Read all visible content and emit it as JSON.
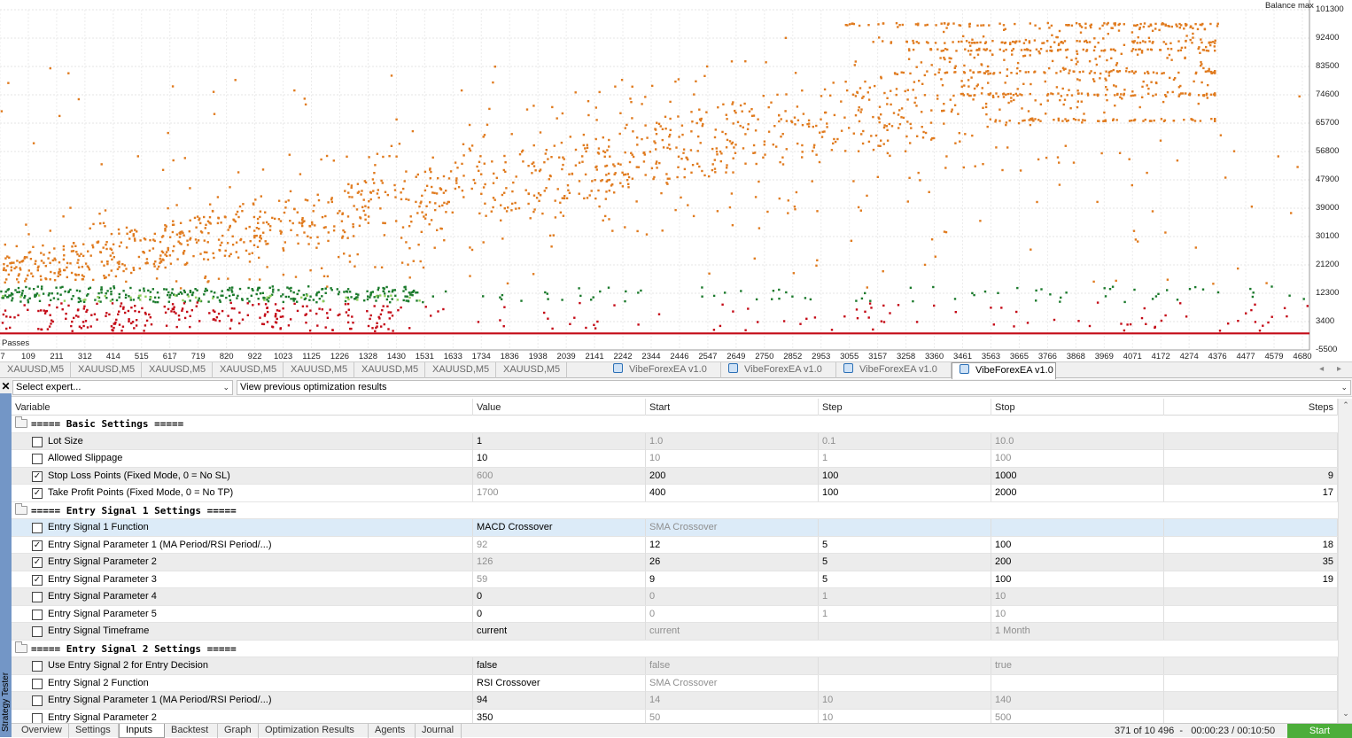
{
  "chart": {
    "y_title": "Balance max",
    "x_title": "Passes",
    "y_ticks": [
      "101300",
      "92400",
      "83500",
      "74600",
      "65700",
      "56800",
      "47900",
      "39000",
      "30100",
      "21200",
      "12300",
      "3400",
      "-5500"
    ],
    "x_ticks": [
      "7",
      "109",
      "211",
      "312",
      "414",
      "515",
      "617",
      "719",
      "820",
      "922",
      "1023",
      "1125",
      "1226",
      "1328",
      "1430",
      "1531",
      "1633",
      "1734",
      "1836",
      "1938",
      "2039",
      "2141",
      "2242",
      "2344",
      "2446",
      "2547",
      "2649",
      "2750",
      "2852",
      "2953",
      "3055",
      "3157",
      "3258",
      "3360",
      "3461",
      "3563",
      "3665",
      "3766",
      "3868",
      "3969",
      "4071",
      "4172",
      "4274",
      "4376",
      "4477",
      "4579",
      "4680"
    ],
    "colors": {
      "profit": "#e07b1f",
      "mid": "#1b7a2c",
      "loss": "#c40a16",
      "light": "#8fcf5a"
    }
  },
  "chart_data": {
    "type": "scatter",
    "xlabel": "Passes",
    "ylabel": "Balance max",
    "xlim": [
      7,
      4720
    ],
    "ylim": [
      -5500,
      101300
    ],
    "series": []
  },
  "chart_tabs": [
    {
      "label": "XAUUSD,M5",
      "icon": false,
      "active": false
    },
    {
      "label": "XAUUSD,M5",
      "icon": false,
      "active": false
    },
    {
      "label": "XAUUSD,M5",
      "icon": false,
      "active": false
    },
    {
      "label": "XAUUSD,M5",
      "icon": false,
      "active": false
    },
    {
      "label": "XAUUSD,M5",
      "icon": false,
      "active": false
    },
    {
      "label": "XAUUSD,M5",
      "icon": false,
      "active": false
    },
    {
      "label": "XAUUSD,M5",
      "icon": false,
      "active": false
    },
    {
      "label": "XAUUSD,M5",
      "icon": false,
      "active": false
    },
    {
      "label": "VibeForexEA v1.0",
      "icon": true,
      "active": false
    },
    {
      "label": "VibeForexEA v1.0",
      "icon": true,
      "active": false
    },
    {
      "label": "VibeForexEA v1.0",
      "icon": true,
      "active": false
    },
    {
      "label": "VibeForexEA v1.0",
      "icon": true,
      "active": true
    }
  ],
  "side_panel": {
    "label": "Strategy Tester"
  },
  "toolbar": {
    "expert_select": "Select expert...",
    "results_select": "View previous optimization results"
  },
  "grid": {
    "headers": [
      "Variable",
      "Value",
      "Start",
      "Step",
      "Stop",
      "Steps"
    ],
    "rows": [
      {
        "type": "group",
        "label": "===== Basic Settings ====="
      },
      {
        "type": "param",
        "checked": false,
        "name": "Lot Size",
        "value": "1",
        "start": "1.0",
        "step": "0.1",
        "stop": "10.0",
        "steps": "",
        "value_dim": false,
        "start_dim": true,
        "step_dim": true,
        "stop_dim": true
      },
      {
        "type": "param",
        "checked": false,
        "name": "Allowed Slippage",
        "value": "10",
        "start": "10",
        "step": "1",
        "stop": "100",
        "steps": "",
        "value_dim": false,
        "start_dim": true,
        "step_dim": true,
        "stop_dim": true
      },
      {
        "type": "param",
        "checked": true,
        "name": "Stop Loss Points (Fixed Mode, 0 = No SL)",
        "value": "600",
        "start": "200",
        "step": "100",
        "stop": "1000",
        "steps": "9",
        "value_dim": true,
        "start_dim": false,
        "step_dim": false,
        "stop_dim": false
      },
      {
        "type": "param",
        "checked": true,
        "name": "Take Profit Points (Fixed Mode, 0 = No TP)",
        "value": "1700",
        "start": "400",
        "step": "100",
        "stop": "2000",
        "steps": "17",
        "value_dim": true,
        "start_dim": false,
        "step_dim": false,
        "stop_dim": false
      },
      {
        "type": "group",
        "label": "===== Entry Signal 1 Settings ====="
      },
      {
        "type": "param",
        "checked": false,
        "name": "Entry Signal 1 Function",
        "value": "MACD Crossover",
        "start": "SMA Crossover",
        "step": "",
        "stop": "",
        "steps": "",
        "value_dim": false,
        "start_dim": true,
        "step_dim": true,
        "stop_dim": true,
        "selected": true
      },
      {
        "type": "param",
        "checked": true,
        "name": "Entry Signal Parameter 1 (MA Period/RSI Period/...)",
        "value": "92",
        "start": "12",
        "step": "5",
        "stop": "100",
        "steps": "18",
        "value_dim": true,
        "start_dim": false,
        "step_dim": false,
        "stop_dim": false
      },
      {
        "type": "param",
        "checked": true,
        "name": "Entry Signal Parameter 2",
        "value": "126",
        "start": "26",
        "step": "5",
        "stop": "200",
        "steps": "35",
        "value_dim": true,
        "start_dim": false,
        "step_dim": false,
        "stop_dim": false
      },
      {
        "type": "param",
        "checked": true,
        "name": "Entry Signal Parameter 3",
        "value": "59",
        "start": "9",
        "step": "5",
        "stop": "100",
        "steps": "19",
        "value_dim": true,
        "start_dim": false,
        "step_dim": false,
        "stop_dim": false
      },
      {
        "type": "param",
        "checked": false,
        "name": "Entry Signal Parameter 4",
        "value": "0",
        "start": "0",
        "step": "1",
        "stop": "10",
        "steps": "",
        "value_dim": false,
        "start_dim": true,
        "step_dim": true,
        "stop_dim": true
      },
      {
        "type": "param",
        "checked": false,
        "name": "Entry Signal Parameter 5",
        "value": "0",
        "start": "0",
        "step": "1",
        "stop": "10",
        "steps": "",
        "value_dim": false,
        "start_dim": true,
        "step_dim": true,
        "stop_dim": true
      },
      {
        "type": "param",
        "checked": false,
        "name": "Entry Signal Timeframe",
        "value": "current",
        "start": "current",
        "step": "",
        "stop": "1 Month",
        "steps": "",
        "value_dim": false,
        "start_dim": true,
        "step_dim": true,
        "stop_dim": true
      },
      {
        "type": "group",
        "label": "===== Entry Signal 2 Settings ====="
      },
      {
        "type": "param",
        "checked": false,
        "name": "Use Entry Signal 2 for Entry Decision",
        "value": "false",
        "start": "false",
        "step": "",
        "stop": "true",
        "steps": "",
        "value_dim": false,
        "start_dim": true,
        "step_dim": true,
        "stop_dim": true
      },
      {
        "type": "param",
        "checked": false,
        "name": "Entry Signal 2 Function",
        "value": "RSI Crossover",
        "start": "SMA Crossover",
        "step": "",
        "stop": "",
        "steps": "",
        "value_dim": false,
        "start_dim": true,
        "step_dim": true,
        "stop_dim": true
      },
      {
        "type": "param",
        "checked": false,
        "name": "Entry Signal Parameter 1 (MA Period/RSI Period/...)",
        "value": "94",
        "start": "14",
        "step": "10",
        "stop": "140",
        "steps": "",
        "value_dim": false,
        "start_dim": true,
        "step_dim": true,
        "stop_dim": true
      },
      {
        "type": "param",
        "checked": false,
        "name": "Entry Signal Parameter 2",
        "value": "350",
        "start": "50",
        "step": "10",
        "stop": "500",
        "steps": "",
        "value_dim": false,
        "start_dim": true,
        "step_dim": true,
        "stop_dim": true
      }
    ]
  },
  "bottom_tabs": [
    {
      "label": "Overview",
      "active": false
    },
    {
      "label": "Settings",
      "active": false
    },
    {
      "label": "Inputs",
      "active": true
    },
    {
      "label": "Backtest",
      "active": false
    },
    {
      "label": "Graph",
      "active": false
    },
    {
      "label": "Optimization Results",
      "active": false
    },
    {
      "label": "Agents",
      "active": false
    },
    {
      "label": "Journal",
      "active": false
    }
  ],
  "status": {
    "progress": "371 of 10 496",
    "times": "00:00:23 / 00:10:50",
    "start_label": "Start"
  }
}
